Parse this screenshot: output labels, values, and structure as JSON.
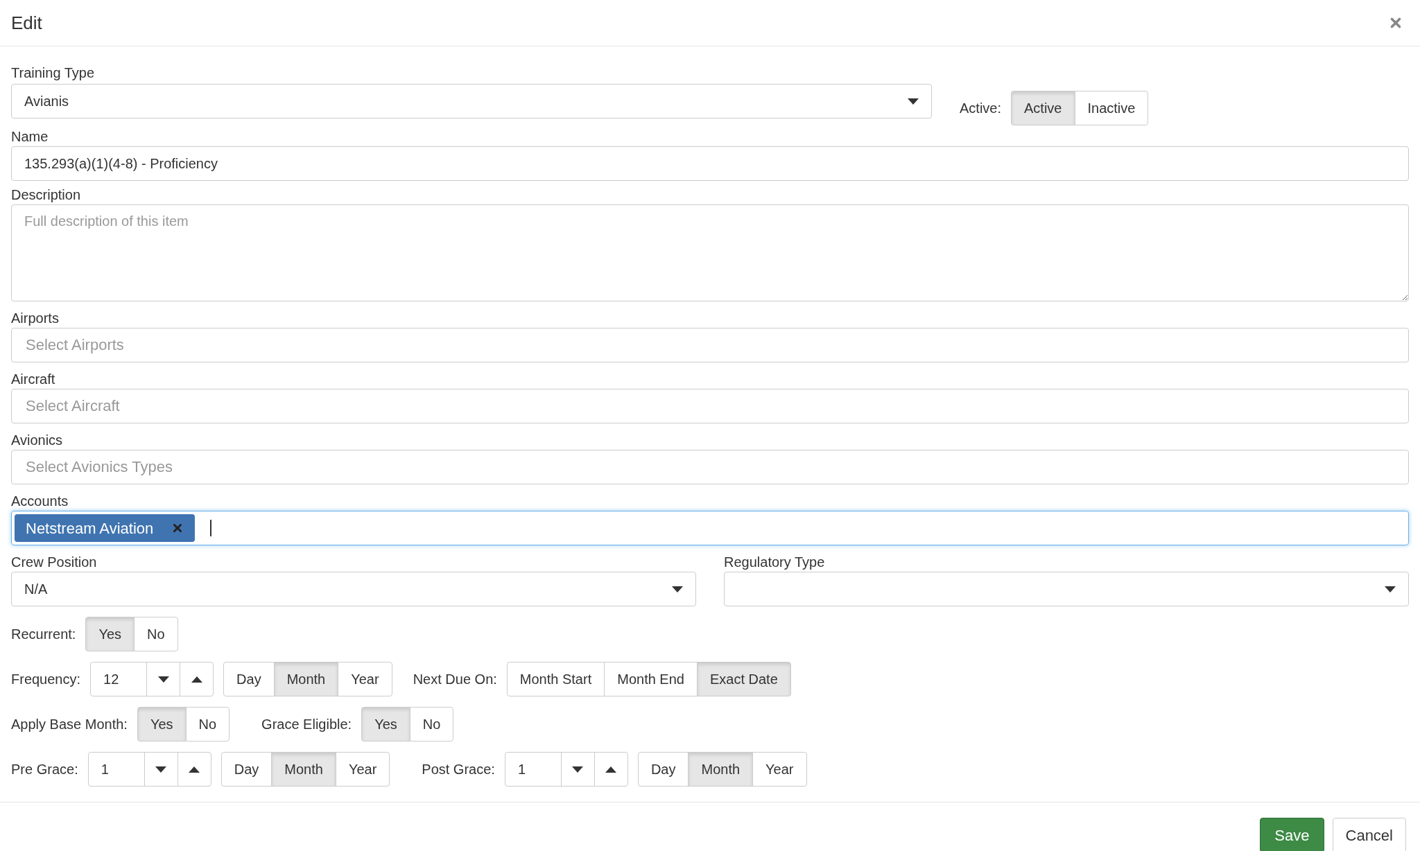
{
  "dialog": {
    "title": "Edit"
  },
  "training_type": {
    "label": "Training Type",
    "value": "Avianis"
  },
  "active": {
    "label": "Active:",
    "options": [
      {
        "label": "Active",
        "selected": true
      },
      {
        "label": "Inactive",
        "selected": false
      }
    ]
  },
  "name": {
    "label": "Name",
    "value": "135.293(a)(1)(4-8) - Proficiency"
  },
  "description": {
    "label": "Description",
    "placeholder": "Full description of this item"
  },
  "pickers": [
    {
      "label": "Airports",
      "placeholder": "Select Airports"
    },
    {
      "label": "Aircraft",
      "placeholder": "Select Aircraft"
    },
    {
      "label": "Avionics",
      "placeholder": "Select Avionics Types"
    }
  ],
  "accounts": {
    "label": "Accounts",
    "focused": true,
    "tags": [
      {
        "label": "Netstream Aviation"
      }
    ]
  },
  "crew_position": {
    "label": "Crew Position",
    "value": "N/A"
  },
  "regulatory_type": {
    "label": "Regulatory Type"
  },
  "recurrent": {
    "label": "Recurrent:",
    "options": [
      {
        "label": "Yes",
        "selected": true
      },
      {
        "label": "No",
        "selected": false
      }
    ]
  },
  "frequency": {
    "label": "Frequency:",
    "value": "12",
    "units": [
      {
        "label": "Day",
        "selected": false
      },
      {
        "label": "Month",
        "selected": true
      },
      {
        "label": "Year",
        "selected": false
      }
    ]
  },
  "next_due_on": {
    "label": "Next Due On:",
    "options": [
      {
        "label": "Month Start",
        "selected": false
      },
      {
        "label": "Month End",
        "selected": false
      },
      {
        "label": "Exact Date",
        "selected": true
      }
    ]
  },
  "apply_base_month": {
    "label": "Apply Base Month:",
    "options": [
      {
        "label": "Yes",
        "selected": true
      },
      {
        "label": "No",
        "selected": false
      }
    ]
  },
  "grace_eligible": {
    "label": "Grace Eligible:",
    "options": [
      {
        "label": "Yes",
        "selected": true
      },
      {
        "label": "No",
        "selected": false
      }
    ]
  },
  "pre_grace": {
    "label": "Pre Grace:",
    "value": "1",
    "units": [
      {
        "label": "Day",
        "selected": false
      },
      {
        "label": "Month",
        "selected": true
      },
      {
        "label": "Year",
        "selected": false
      }
    ]
  },
  "post_grace": {
    "label": "Post Grace:",
    "value": "1",
    "units": [
      {
        "label": "Day",
        "selected": false
      },
      {
        "label": "Month",
        "selected": true
      },
      {
        "label": "Year",
        "selected": false
      }
    ]
  },
  "buttons": {
    "save": "Save",
    "cancel": "Cancel"
  }
}
